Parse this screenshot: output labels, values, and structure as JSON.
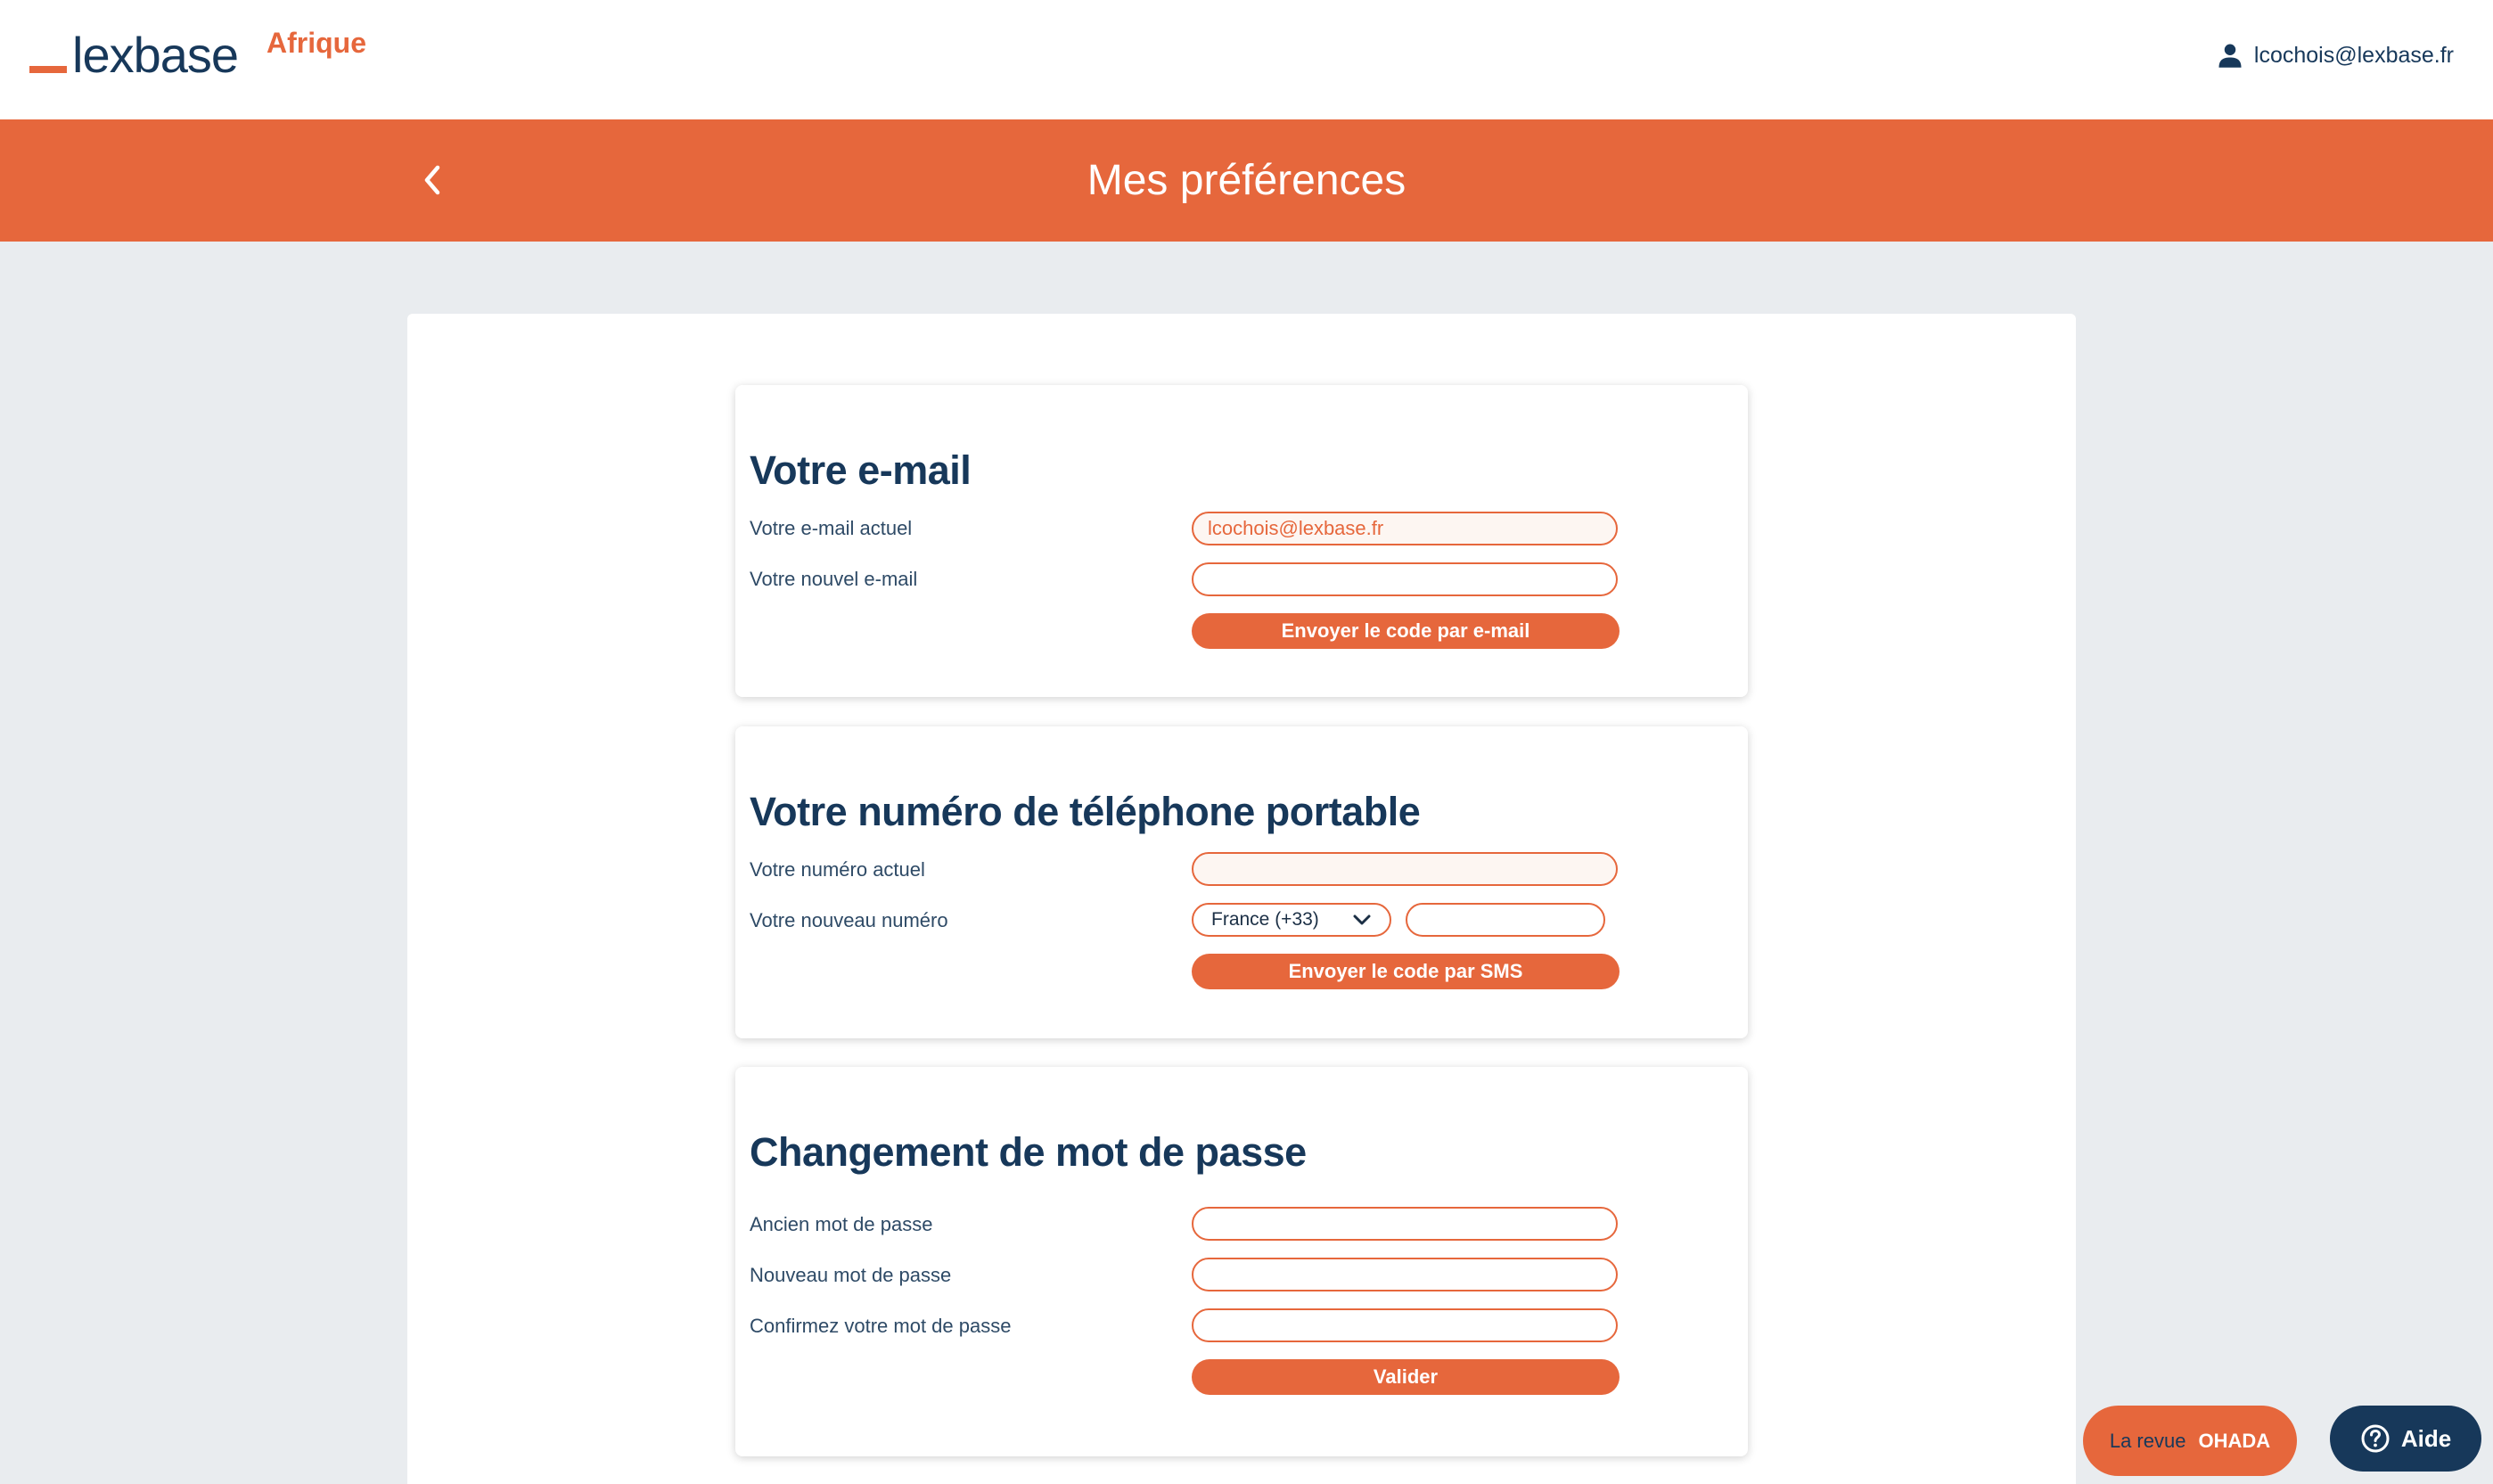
{
  "header": {
    "logo_word": "lexbase",
    "logo_sub": "Afrique",
    "user_email": "lcochois@lexbase.fr"
  },
  "banner": {
    "title": "Mes préférences"
  },
  "email_section": {
    "title": "Votre e-mail",
    "current_label": "Votre e-mail actuel",
    "current_value": "lcochois@lexbase.fr",
    "new_label": "Votre nouvel e-mail",
    "new_value": "",
    "send_button": "Envoyer le code par e-mail"
  },
  "phone_section": {
    "title": "Votre numéro de téléphone portable",
    "current_label": "Votre numéro actuel",
    "current_value": "",
    "new_label": "Votre nouveau numéro",
    "country_selected": "France (+33)",
    "new_value": "",
    "send_button": "Envoyer le code par SMS"
  },
  "password_section": {
    "title": "Changement de mot de passe",
    "old_label": "Ancien mot de passe",
    "new_label": "Nouveau mot de passe",
    "confirm_label": "Confirmez votre mot de passe",
    "submit_button": "Valider"
  },
  "floating": {
    "revue_prefix": "La revue",
    "revue_name": "OHADA",
    "help_label": "Aide"
  },
  "colors": {
    "accent": "#e6673c",
    "navy": "#17385a",
    "page_bg": "#e9ecef"
  },
  "icons": [
    "user-icon",
    "chevron-left-icon",
    "chevron-down-icon",
    "help-circle-icon"
  ]
}
